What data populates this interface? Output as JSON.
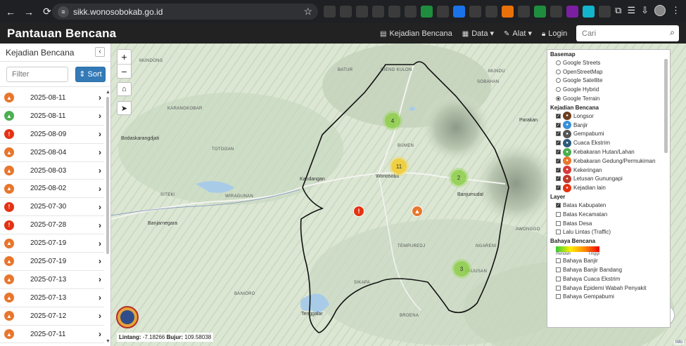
{
  "browser": {
    "url": "sikk.wonosobokab.go.id",
    "extensions": [
      {
        "icon": "slash-ext-icon",
        "color": "#3b3b3b"
      },
      {
        "icon": "n-ext-icon",
        "color": "#3b3b3b"
      },
      {
        "icon": "puzzle-ext-icon",
        "color": "#3b3b3b"
      },
      {
        "icon": "a-ext-icon",
        "color": "#3b3b3b"
      },
      {
        "icon": "chart-ext-icon",
        "color": "#3b3b3b"
      },
      {
        "icon": "pin-ext-icon",
        "color": "#3b3b3b"
      },
      {
        "icon": "dollar-ext-icon",
        "color": "#1e8e3e"
      },
      {
        "icon": "square-ext-icon",
        "color": "#3b3b3b"
      },
      {
        "icon": "badge-ext-icon",
        "color": "#1a73e8"
      },
      {
        "icon": "play-ext-icon",
        "color": "#3b3b3b"
      },
      {
        "icon": "wave-ext-icon",
        "color": "#3b3b3b"
      },
      {
        "icon": "orange-ext-icon",
        "color": "#e8710a"
      },
      {
        "icon": "gem-ext-icon",
        "color": "#3b3b3b"
      },
      {
        "icon": "leaf-ext-icon",
        "color": "#1e8e3e"
      },
      {
        "icon": "lines-ext-icon",
        "color": "#3b3b3b"
      },
      {
        "icon": "purple-ext-icon",
        "color": "#7b1fa2"
      },
      {
        "icon": "cyan-ext-icon",
        "color": "#12b5cb"
      },
      {
        "icon": "a2-ext-icon",
        "color": "#3b3b3b"
      }
    ]
  },
  "navbar": {
    "brand": "Pantauan Bencana",
    "menu": [
      {
        "icon": "list-icon",
        "label": "Kejadian Bencana"
      },
      {
        "icon": "table-icon",
        "label": "Data"
      },
      {
        "icon": "wrench-icon",
        "label": "Alat"
      },
      {
        "icon": "lock-icon",
        "label": "Login"
      },
      {
        "icon": "info-icon",
        "label": "ℹ"
      }
    ],
    "search_placeholder": "Cari"
  },
  "sidebar": {
    "title": "Kejadian Bencana",
    "filter_placeholder": "Filter",
    "sort_label": "Sort",
    "events": [
      {
        "date": "2025-08-11",
        "type": "fire",
        "color": "#e8762c"
      },
      {
        "date": "2025-08-11",
        "type": "forest-fire",
        "color": "#4caf50"
      },
      {
        "date": "2025-08-09",
        "type": "other",
        "color": "#e53212"
      },
      {
        "date": "2025-08-04",
        "type": "fire",
        "color": "#e8762c"
      },
      {
        "date": "2025-08-03",
        "type": "fire",
        "color": "#e8762c"
      },
      {
        "date": "2025-08-02",
        "type": "fire",
        "color": "#e8762c"
      },
      {
        "date": "2025-07-30",
        "type": "other",
        "color": "#e53212"
      },
      {
        "date": "2025-07-28",
        "type": "other",
        "color": "#e53212"
      },
      {
        "date": "2025-07-19",
        "type": "fire",
        "color": "#e8762c"
      },
      {
        "date": "2025-07-19",
        "type": "fire",
        "color": "#e8762c"
      },
      {
        "date": "2025-07-13",
        "type": "fire",
        "color": "#e8762c"
      },
      {
        "date": "2025-07-13",
        "type": "fire",
        "color": "#e8762c"
      },
      {
        "date": "2025-07-12",
        "type": "fire",
        "color": "#e8762c"
      },
      {
        "date": "2025-07-11",
        "type": "fire",
        "color": "#e8762c"
      }
    ]
  },
  "map": {
    "places": [
      {
        "name": "Mundong",
        "cls": ""
      },
      {
        "name": "Karangkobar",
        "cls": ""
      },
      {
        "name": "Bodaskarangdjati",
        "cls": "town"
      },
      {
        "name": "Totogan",
        "cls": ""
      },
      {
        "name": "Siteki",
        "cls": ""
      },
      {
        "name": "Wiragunan",
        "cls": ""
      },
      {
        "name": "Banjarnegara",
        "cls": "town"
      },
      {
        "name": "Batur",
        "cls": ""
      },
      {
        "name": "Dieng Kulon",
        "cls": ""
      },
      {
        "name": "Mundu",
        "cls": ""
      },
      {
        "name": "Sobahan",
        "cls": ""
      },
      {
        "name": "Parakan",
        "cls": "town"
      },
      {
        "name": "Bumen",
        "cls": ""
      },
      {
        "name": "Kandangan",
        "cls": "town"
      },
      {
        "name": "Wonosobo",
        "cls": "town"
      },
      {
        "name": "Banjumudal",
        "cls": "town"
      },
      {
        "name": "Tempuredj",
        "cls": ""
      },
      {
        "name": "Ngareni",
        "cls": ""
      },
      {
        "name": "Awonggo",
        "cls": ""
      },
      {
        "name": "Sikapa",
        "cls": ""
      },
      {
        "name": "Banioro",
        "cls": ""
      },
      {
        "name": "Tenggalar",
        "cls": "town"
      },
      {
        "name": "Broena",
        "cls": ""
      },
      {
        "name": "Bauusan",
        "cls": ""
      }
    ],
    "clusters": [
      {
        "count": "4",
        "style": "g"
      },
      {
        "count": "11",
        "style": "y"
      },
      {
        "count": "2",
        "style": "g"
      },
      {
        "count": "3",
        "style": "g"
      }
    ],
    "markers": [
      {
        "type": "other",
        "color": "#e53212",
        "glyph": "!"
      },
      {
        "type": "fire",
        "color": "#e8762c",
        "glyph": "🔥"
      }
    ],
    "coords": {
      "lat_label": "Lintang:",
      "lat": "-7.18266",
      "lon_label": "Bujur:",
      "lon": "109.58038"
    },
    "attribution": "Info"
  },
  "legend": {
    "basemap_title": "Basemap",
    "basemaps": [
      {
        "label": "Google Streets",
        "checked": false
      },
      {
        "label": "OpenStreetMap",
        "checked": false
      },
      {
        "label": "Google Satellite",
        "checked": false
      },
      {
        "label": "Google Hybrid",
        "checked": false
      },
      {
        "label": "Google Terrain",
        "checked": true
      }
    ],
    "events_title": "Kejadian Bencana",
    "events": [
      {
        "label": "Longsor",
        "color": "#6b3e1f",
        "icon": "landslide-icon"
      },
      {
        "label": "Banjir",
        "color": "#3a8fd9",
        "icon": "flood-icon"
      },
      {
        "label": "Gempabumi",
        "color": "#555555",
        "icon": "earthquake-icon"
      },
      {
        "label": "Cuaca Ekstrim",
        "color": "#2e5a7a",
        "icon": "storm-icon"
      },
      {
        "label": "Kebakaran Hutan/Lahan",
        "color": "#4caf50",
        "icon": "forest-fire-icon"
      },
      {
        "label": "Kebakaran Gedung/Permukiman",
        "color": "#e8762c",
        "icon": "building-fire-icon"
      },
      {
        "label": "Kekeringan",
        "color": "#d73a3a",
        "icon": "drought-icon"
      },
      {
        "label": "Letusan Gunungapi",
        "color": "#c0392b",
        "icon": "volcano-icon"
      },
      {
        "label": "Kejadian lain",
        "color": "#e53212",
        "icon": "alert-icon"
      }
    ],
    "layer_title": "Layer",
    "layers": [
      {
        "label": "Batas Kabupaten",
        "checked": true
      },
      {
        "label": "Batas Kecamatan",
        "checked": false
      },
      {
        "label": "Batas Desa",
        "checked": false
      },
      {
        "label": "Lalu Lintas (Traffic)",
        "checked": false
      }
    ],
    "hazard_title": "Bahaya Bencana",
    "ramp_low": "Rendah",
    "ramp_high": "Tinggi",
    "hazards": [
      {
        "label": "Bahaya Banjir",
        "checked": false
      },
      {
        "label": "Bahaya Banjir Bandang",
        "checked": false
      },
      {
        "label": "Bahaya Cuaca Ekstrim",
        "checked": false
      },
      {
        "label": "Bahaya Epidemi Wabah Penyakit",
        "checked": false
      },
      {
        "label": "Bahaya Gempabumi",
        "checked": false
      }
    ]
  }
}
